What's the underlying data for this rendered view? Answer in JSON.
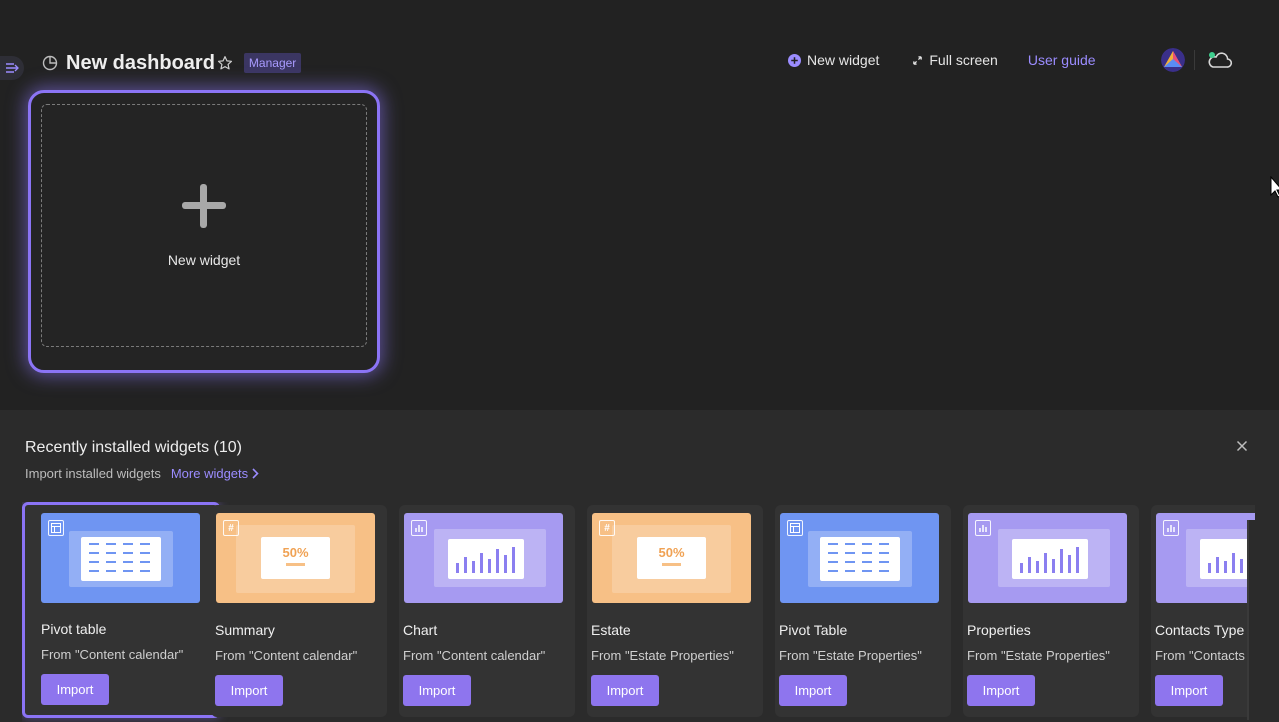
{
  "header": {
    "title": "New dashboard",
    "role_badge": "Manager"
  },
  "toolbar": {
    "new_widget_label": "New widget",
    "full_screen_label": "Full screen",
    "user_guide_label": "User guide"
  },
  "canvas": {
    "new_widget_label": "New widget"
  },
  "panel": {
    "title": "Recently installed widgets (10)",
    "subtitle": "Import installed widgets",
    "more_link": "More widgets",
    "cards": [
      {
        "name": "Pivot table",
        "source": "From \"Content calendar\"",
        "button": "Import",
        "kind": "pivot",
        "color": "#6f95f2",
        "selected": true
      },
      {
        "name": "Summary",
        "source": "From \"Content calendar\"",
        "button": "Import",
        "kind": "summary",
        "color": "#f7c086",
        "selected": false,
        "thumb_value": "50%"
      },
      {
        "name": "Chart",
        "source": "From \"Content calendar\"",
        "button": "Import",
        "kind": "chart",
        "color": "#a69af1",
        "selected": false
      },
      {
        "name": "Estate",
        "source": "From \"Estate Properties\"",
        "button": "Import",
        "kind": "summary",
        "color": "#f7c086",
        "selected": false,
        "thumb_value": "50%"
      },
      {
        "name": "Pivot Table",
        "source": "From \"Estate Properties\"",
        "button": "Import",
        "kind": "pivot",
        "color": "#6f95f2",
        "selected": false
      },
      {
        "name": "Properties",
        "source": "From \"Estate Properties\"",
        "button": "Import",
        "kind": "chart",
        "color": "#a69af1",
        "selected": false
      },
      {
        "name": "Contacts Type",
        "source": "From \"Contacts",
        "button": "Import",
        "kind": "chart",
        "color": "#a69af1",
        "selected": false
      }
    ]
  },
  "colors": {
    "accent": "#8b74f5",
    "link": "#9b8cff",
    "pivot": "#6f95f2",
    "summary": "#f7c086",
    "chart": "#a69af1"
  }
}
